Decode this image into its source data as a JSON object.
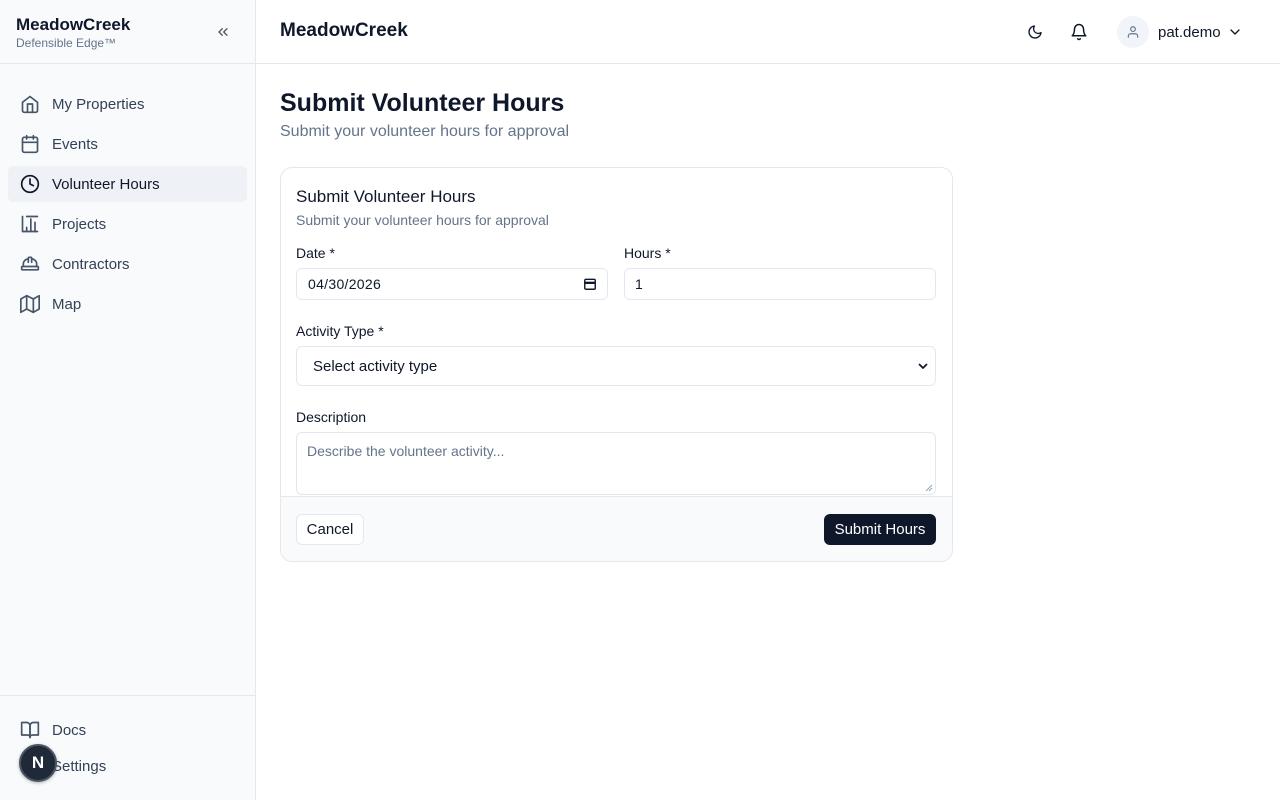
{
  "sidebar": {
    "brand_name": "MeadowCreek",
    "brand_tag": "Defensible Edge™",
    "items": [
      {
        "label": "My Properties",
        "icon": "home-icon"
      },
      {
        "label": "Events",
        "icon": "calendar-icon"
      },
      {
        "label": "Volunteer Hours",
        "icon": "clock-icon",
        "active": true
      },
      {
        "label": "Projects",
        "icon": "chart-icon"
      },
      {
        "label": "Contractors",
        "icon": "hard-hat-icon"
      },
      {
        "label": "Map",
        "icon": "map-icon"
      }
    ],
    "bottom_items": [
      {
        "label": "Docs",
        "icon": "book-icon"
      },
      {
        "label": "Settings",
        "icon": "gear-icon"
      }
    ],
    "avatar_letter": "N"
  },
  "header": {
    "title": "MeadowCreek",
    "username": "pat.demo"
  },
  "page": {
    "title": "Submit Volunteer Hours",
    "subtitle": "Submit your volunteer hours for approval"
  },
  "form": {
    "card_title": "Submit Volunteer Hours",
    "card_subtitle": "Submit your volunteer hours for approval",
    "date_label": "Date *",
    "date_value": "04/30/2026",
    "hours_label": "Hours *",
    "hours_value": "1",
    "activity_label": "Activity Type *",
    "activity_value": "Select activity type",
    "description_label": "Description",
    "description_placeholder": "Describe the volunteer activity...",
    "cancel_label": "Cancel",
    "submit_label": "Submit Hours"
  },
  "colors": {
    "primary": "#0f172a",
    "muted": "#64748b",
    "sidebar_bg": "#f8fafc",
    "active_bg": "#eef1f5"
  }
}
